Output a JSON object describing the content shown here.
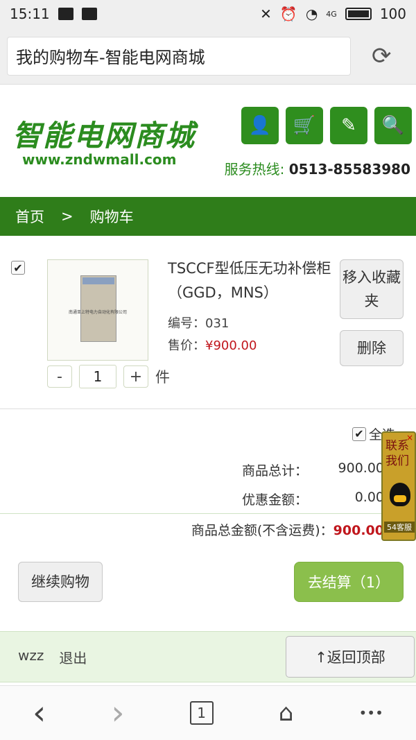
{
  "status": {
    "time": "15:11",
    "battery": "100",
    "network": "4G"
  },
  "browser": {
    "url_text": "我的购物车-智能电网商城"
  },
  "header": {
    "logo_cn": "智能电网商城",
    "logo_url": "www.zndwmall.com",
    "hotline_label": "服务热线:",
    "hotline_number": "0513-85583980",
    "icons": [
      "user-icon",
      "cart-icon",
      "edit-icon",
      "search-icon"
    ],
    "cart_count": "1"
  },
  "breadcrumb": {
    "home": "首页",
    "sep": ">",
    "current": "购物车"
  },
  "cart_item": {
    "name": "TSCCF型低压无功补偿柜（GGD，MNS）",
    "code_label": "编号：",
    "code": "031",
    "price_label": "售价：",
    "price": "¥900.00",
    "thumb_caption": "南通亚上特电力自动化有限公司",
    "favorite_btn": "移入收藏夹",
    "delete_btn": "删除",
    "qty_minus": "-",
    "qty_value": "1",
    "qty_plus": "+",
    "unit": "件"
  },
  "summary": {
    "select_all": "全选",
    "subtotal_label": "商品总计：",
    "subtotal_value": "900.00",
    "discount_label": "优惠金额：",
    "discount_value": "0.00",
    "total_label": "商品总金额(不含运费)：",
    "total_value": "900.00"
  },
  "float_contact": {
    "text": "联系我们",
    "online": "54客服",
    "close": "×"
  },
  "actions": {
    "continue": "继续购物",
    "checkout": "去结算（1）"
  },
  "footer": {
    "user": "wzz",
    "logout": "退出",
    "to_top": "↑返回顶部"
  },
  "nav": {
    "back": "‹",
    "forward": "›",
    "tabs_count": "1",
    "home": "⌂",
    "more": "•••"
  },
  "colors": {
    "brand_green": "#2f7d1a",
    "price_red": "#c0161c",
    "checkout_green": "#8bbf4c"
  }
}
